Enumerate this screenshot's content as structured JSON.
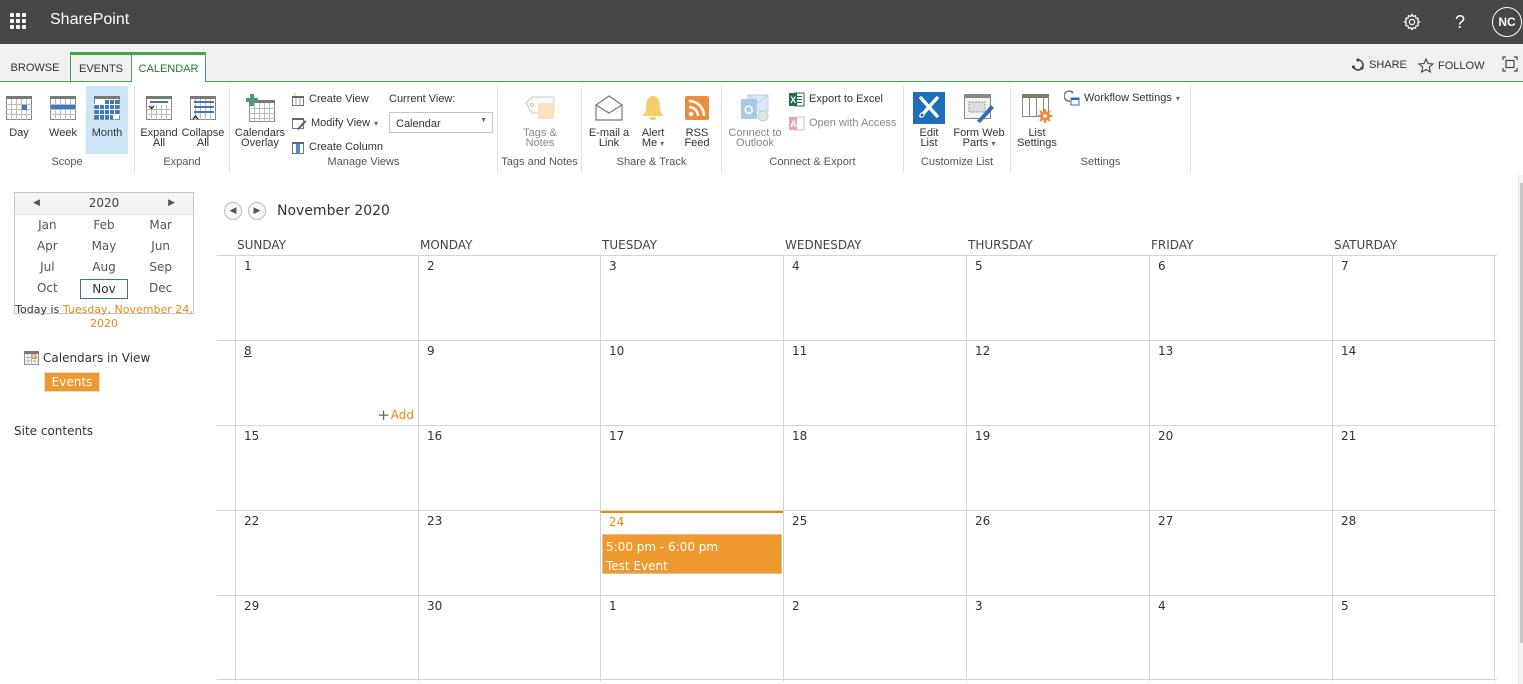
{
  "suitebar": {
    "app_name": "SharePoint",
    "settings_icon": "gear-icon",
    "help_label": "?",
    "avatar_initials": "NC"
  },
  "tabs": [
    {
      "label": "BROWSE",
      "active": false
    },
    {
      "label": "EVENTS",
      "active": false
    },
    {
      "label": "CALENDAR",
      "active": true
    }
  ],
  "tab_actions": {
    "share": "SHARE",
    "follow": "FOLLOW"
  },
  "ribbon": {
    "scope": {
      "label": "Scope",
      "buttons": [
        {
          "label": "Day",
          "selected": false
        },
        {
          "label": "Week",
          "selected": false
        },
        {
          "label": "Month",
          "selected": true
        }
      ]
    },
    "expand": {
      "label": "Expand",
      "buttons": [
        {
          "label": "Expand\nAll"
        },
        {
          "label": "Collapse\nAll"
        }
      ]
    },
    "manage_views": {
      "label": "Manage Views",
      "calendars_overlay": "Calendars\nOverlay",
      "create_view": "Create View",
      "modify_view": "Modify View",
      "create_column": "Create Column",
      "current_view_label": "Current View:",
      "current_view_value": "Calendar"
    },
    "tags_notes": {
      "label": "Tags and Notes",
      "button": "Tags &\nNotes"
    },
    "share_track": {
      "label": "Share & Track",
      "email": "E-mail a\nLink",
      "alert": "Alert\nMe",
      "rss": "RSS\nFeed"
    },
    "connect_export": {
      "label": "Connect & Export",
      "outlook": "Connect to\nOutlook",
      "excel": "Export to Excel",
      "access": "Open with Access"
    },
    "customize_list": {
      "label": "Customize List",
      "edit_list": "Edit\nList",
      "form_web_parts": "Form Web\nParts"
    },
    "settings": {
      "label": "Settings",
      "list_settings": "List\nSettings",
      "workflow_settings": "Workflow Settings"
    }
  },
  "datepicker": {
    "year": "2020",
    "months": [
      "Jan",
      "Feb",
      "Mar",
      "Apr",
      "May",
      "Jun",
      "Jul",
      "Aug",
      "Sep",
      "Oct",
      "Nov",
      "Dec"
    ],
    "selected_month": "Nov",
    "today_prefix": "Today is",
    "today_date": "Tuesday, November 24, 2020"
  },
  "leftnav": {
    "calendars_in_view": "Calendars in View",
    "calendar_chip": "Events",
    "calendar_chip_color": "#ef9a2f",
    "site_contents": "Site contents"
  },
  "calendar": {
    "title": "November 2020",
    "days_of_week": [
      "SUNDAY",
      "MONDAY",
      "TUESDAY",
      "WEDNESDAY",
      "THURSDAY",
      "FRIDAY",
      "SATURDAY"
    ],
    "weeks": [
      [
        "1",
        "2",
        "3",
        "4",
        "5",
        "6",
        "7"
      ],
      [
        "8",
        "9",
        "10",
        "11",
        "12",
        "13",
        "14"
      ],
      [
        "15",
        "16",
        "17",
        "18",
        "19",
        "20",
        "21"
      ],
      [
        "22",
        "23",
        "24",
        "25",
        "26",
        "27",
        "28"
      ],
      [
        "29",
        "30",
        "1",
        "2",
        "3",
        "4",
        "5"
      ]
    ],
    "today": {
      "week": 3,
      "day": 2
    },
    "hover_add": {
      "week": 1,
      "day": 0,
      "label": "Add"
    },
    "events": [
      {
        "week": 3,
        "day": 2,
        "time": "5:00 pm - 6:00 pm",
        "title": "Test Event",
        "color": "#ef9a2f"
      }
    ],
    "accent_color": "#ea8b0f"
  }
}
